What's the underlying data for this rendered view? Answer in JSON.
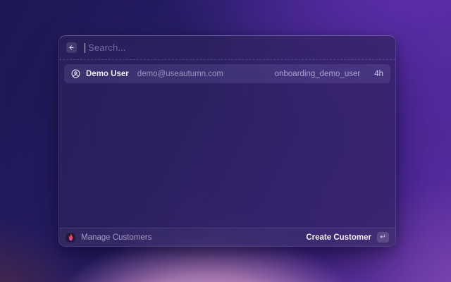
{
  "search": {
    "placeholder": "Search...",
    "back_icon": "arrow-left"
  },
  "results": [
    {
      "name": "Demo User",
      "email": "demo@useautumn.com",
      "id": "onboarding_demo_user",
      "time": "4h",
      "icon": "circle-user"
    }
  ],
  "footer": {
    "left_label": "Manage Customers",
    "logo_icon": "autumn-flame-logo",
    "action_label": "Create Customer",
    "enter_symbol": "↵"
  },
  "colors": {
    "modal_glass": "#2d2357",
    "row_highlight": "#3e3470",
    "accent_text": "#f0edfb",
    "muted_text": "#9c92c1",
    "flame_top": "#f97340",
    "flame_bottom": "#d946ef",
    "background_top_left": "#1d1853",
    "background_top_right": "#5c2da4",
    "background_bottom_center": "#c58ec5"
  }
}
